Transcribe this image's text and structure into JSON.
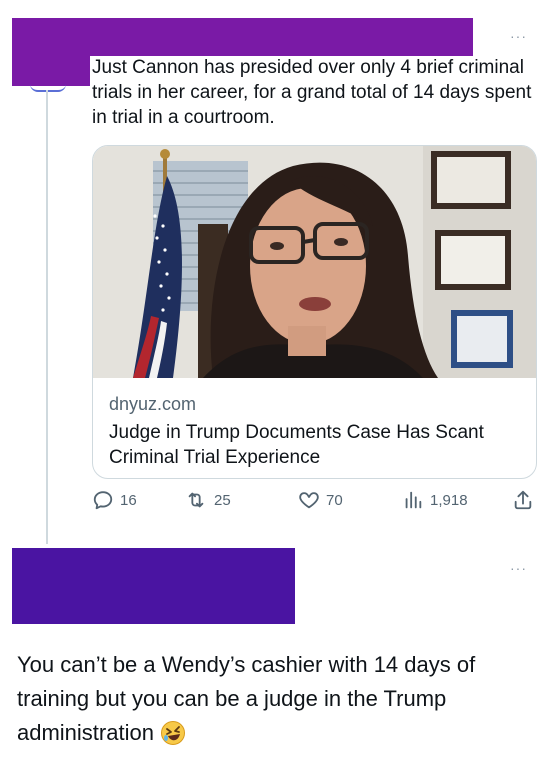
{
  "post": {
    "text": "Just Cannon has presided over only 4 brief criminal trials in her career, for a grand total of 14 days spent in trial in a courtroom.",
    "more_label": "···"
  },
  "card": {
    "domain": "dnyuz.com",
    "title": "Judge in Trump Documents Case Has Scant Criminal Trial Experience"
  },
  "actions": {
    "replies": "16",
    "retweets": "25",
    "likes": "70",
    "views": "1,918"
  },
  "reply": {
    "text": "You can’t be a Wendy’s cashier with 14 days of training but you can be a judge in the Trump administration",
    "more_label": "···"
  },
  "icons": {
    "reply": "reply-icon",
    "retweet": "retweet-icon",
    "like": "heart-icon",
    "views": "views-icon",
    "share": "share-icon",
    "emoji": "rofl-emoji-icon"
  },
  "colors": {
    "redaction_top": "#7a1aa6",
    "redaction_bottom": "#4a14a2",
    "text": "#0f1419",
    "muted": "#536471"
  }
}
